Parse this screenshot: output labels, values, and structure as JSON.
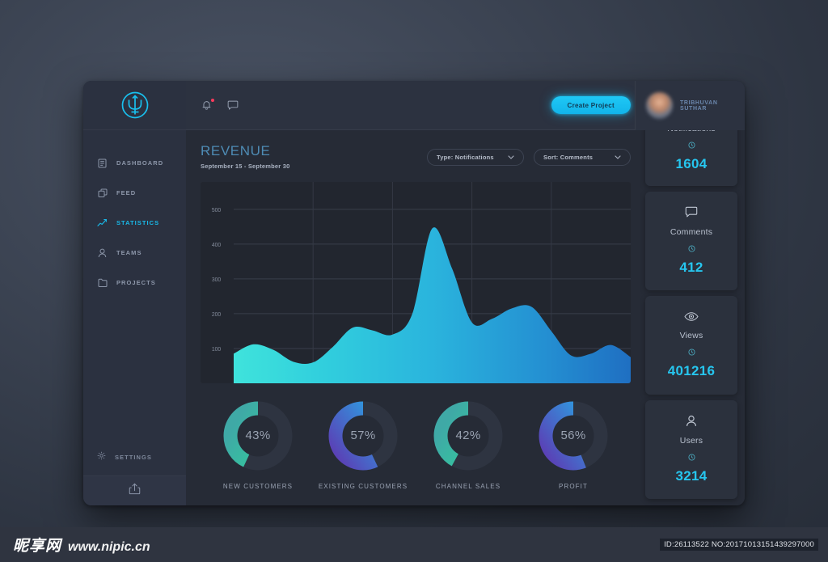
{
  "brand": {
    "logo_icon": "trident-logo-icon",
    "accent": "#19b9e8"
  },
  "sidebar": {
    "items": [
      {
        "label": "DASHBOARD",
        "icon": "dashboard-icon",
        "active": false
      },
      {
        "label": "FEED",
        "icon": "feed-icon",
        "active": false
      },
      {
        "label": "STATISTICS",
        "icon": "statistics-icon",
        "active": true
      },
      {
        "label": "TEAMS",
        "icon": "teams-icon",
        "active": false
      },
      {
        "label": "PROJECTS",
        "icon": "projects-icon",
        "active": false
      }
    ],
    "settings_label": "SETTINGS",
    "settings_icon": "gear-icon",
    "share_icon": "share-upload-icon"
  },
  "topbar": {
    "bell_icon": "bell-icon",
    "message_icon": "message-icon",
    "has_notification_dot": true,
    "create_label": "Create Project"
  },
  "profile": {
    "name": "TRIBHUVAN SUTHAR",
    "avatar_icon": "avatar"
  },
  "main": {
    "title": "REVENUE",
    "subtitle": "September 15 - September 30",
    "type_select": {
      "label": "Type: Notifications",
      "icon": "chevron-down-icon"
    },
    "sort_select": {
      "label": "Sort: Comments",
      "icon": "chevron-down-icon"
    }
  },
  "stats": [
    {
      "label": "Notifications",
      "value": "1604",
      "icon": "bell-icon",
      "divider_icon": "clock-circle-icon"
    },
    {
      "label": "Comments",
      "value": "412",
      "icon": "message-icon",
      "divider_icon": "clock-circle-icon"
    },
    {
      "label": "Views",
      "value": "401216",
      "icon": "eye-icon",
      "divider_icon": "clock-circle-icon"
    },
    {
      "label": "Users",
      "value": "3214",
      "icon": "user-icon",
      "divider_icon": "clock-circle-icon"
    }
  ],
  "donuts": [
    {
      "label": "NEW CUSTOMERS",
      "value": "43%",
      "percent": 43,
      "color_from": "#2fd69a",
      "color_to": "#3fa9a6"
    },
    {
      "label": "EXISTING CUSTOMERS",
      "value": "57%",
      "percent": 57,
      "color_from": "#29a7e6",
      "color_to": "#5b3fb5"
    },
    {
      "label": "CHANNEL SALES",
      "value": "42%",
      "percent": 42,
      "color_from": "#2fd69a",
      "color_to": "#3fa9a6"
    },
    {
      "label": "PROFIT",
      "value": "56%",
      "percent": 56,
      "color_from": "#29a7e6",
      "color_to": "#5b3fb5"
    }
  ],
  "chart_data": {
    "type": "area",
    "title": "REVENUE",
    "subtitle": "September 15 - September 30",
    "xlabel": "",
    "ylabel": "",
    "ylim": [
      0,
      560
    ],
    "yticks": [
      100,
      200,
      300,
      400,
      500
    ],
    "grid": true,
    "legend": null,
    "vertical_gridlines": 4,
    "fill_from": "#3fe0dd",
    "fill_to": "#1f73c4",
    "x": [
      0,
      1,
      2,
      3,
      4,
      5,
      6,
      7,
      8,
      9,
      10,
      11,
      12,
      13,
      14,
      15,
      16,
      17,
      18,
      19,
      20
    ],
    "values": [
      85,
      112,
      96,
      62,
      60,
      105,
      160,
      152,
      140,
      200,
      445,
      330,
      175,
      185,
      215,
      220,
      150,
      80,
      85,
      110,
      75
    ]
  },
  "watermark": {
    "site_cn": "昵享网",
    "site_url": "www.nipic.cn",
    "id_text": "ID:26113522 NO:20171013151439297000"
  }
}
